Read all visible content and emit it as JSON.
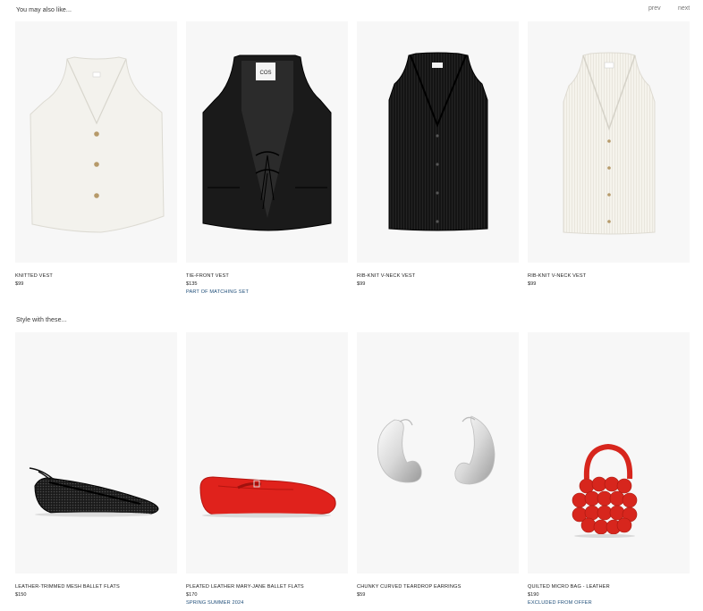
{
  "section1": {
    "title": "You may also like...",
    "prev_label": "prev",
    "next_label": "next",
    "products": [
      {
        "name": "KNITTED VEST",
        "price": "$99",
        "tag": "",
        "image": "white-button-vest-image"
      },
      {
        "name": "TIE-FRONT VEST",
        "price": "$135",
        "tag": "PART OF MATCHING SET",
        "image": "black-tie-front-vest-image",
        "label_text": "COS"
      },
      {
        "name": "RIB-KNIT V-NECK VEST",
        "price": "$99",
        "tag": "",
        "image": "black-rib-knit-vest-image"
      },
      {
        "name": "RIB-KNIT V-NECK VEST",
        "price": "$99",
        "tag": "",
        "image": "cream-rib-knit-vest-image"
      }
    ]
  },
  "section2": {
    "title": "Style with these...",
    "products": [
      {
        "name": "LEATHER-TRIMMED MESH BALLET FLATS",
        "price": "$150",
        "tag": "",
        "image": "black-mesh-flat-image"
      },
      {
        "name": "PLEATED LEATHER MARY-JANE BALLET FLATS",
        "price": "$170",
        "tag": "SPRING SUMMER 2024",
        "image": "red-mary-jane-image"
      },
      {
        "name": "CHUNKY CURVED TEARDROP EARRINGS",
        "price": "$59",
        "tag": "",
        "image": "silver-earrings-image"
      },
      {
        "name": "QUILTED MICRO BAG - LEATHER",
        "price": "$190",
        "tag": "EXCLUDED FROM OFFER",
        "image": "red-quilted-bag-image"
      }
    ]
  },
  "colors": {
    "tile_bg": "#f7f7f7",
    "tag_blue": "#1f4e79",
    "shoe_red": "#e0221c"
  }
}
